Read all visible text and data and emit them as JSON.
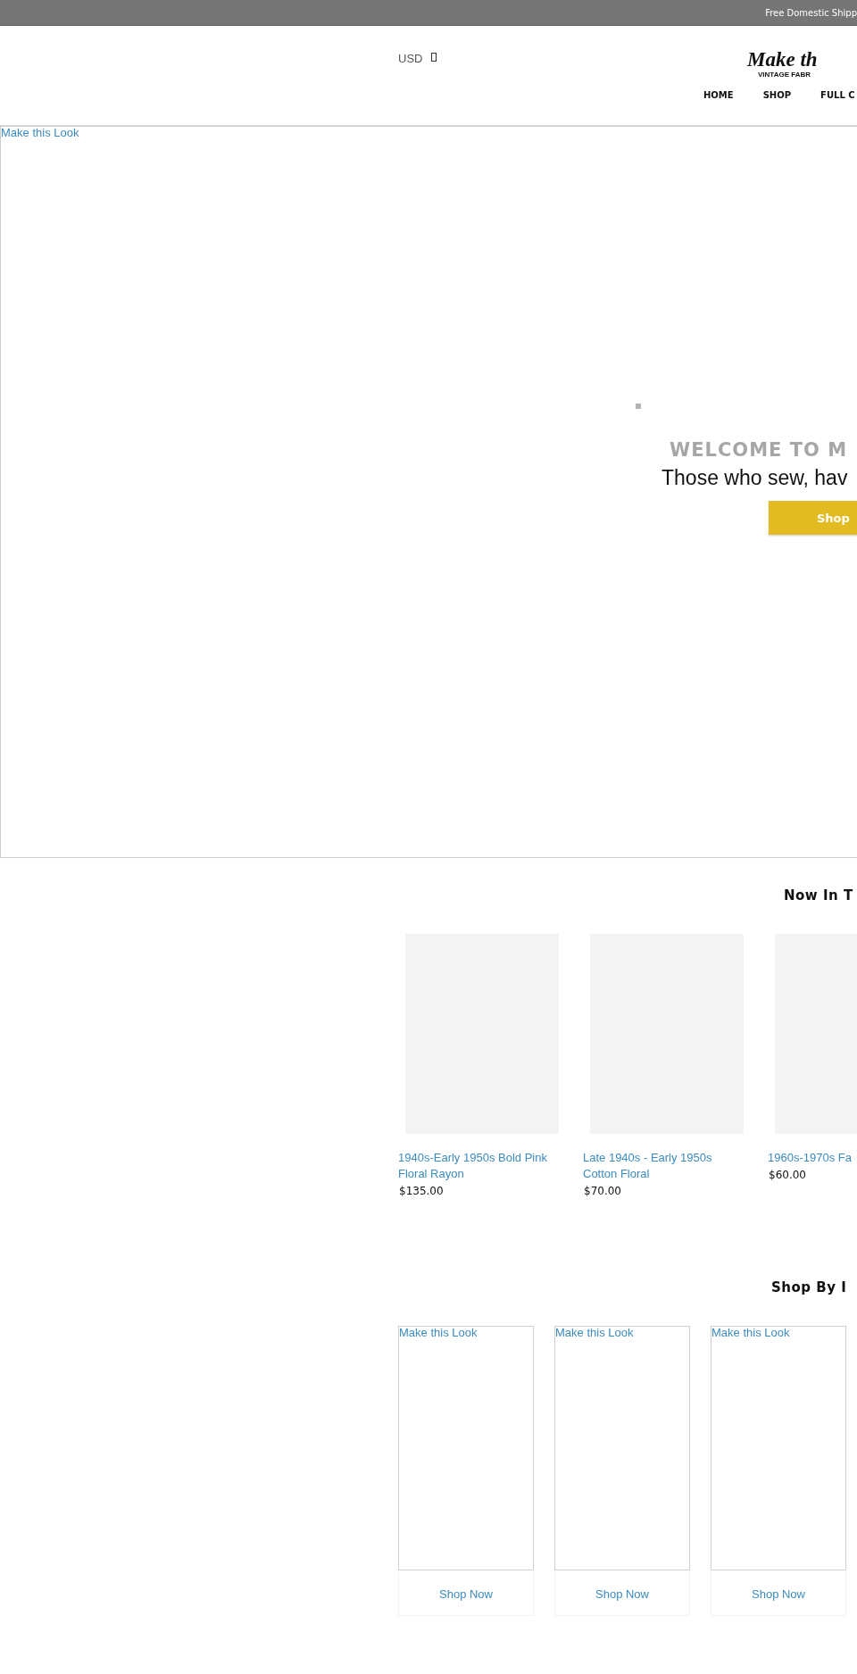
{
  "announcement": "Free Domestic Shipp",
  "header": {
    "currency": "USD",
    "logo": {
      "title": "Make th",
      "subtitle": "VINTAGE FABR"
    },
    "nav": [
      {
        "label": "HOME"
      },
      {
        "label": "SHOP"
      },
      {
        "label": "FULL C"
      }
    ]
  },
  "hero": {
    "image_alt": "Make this Look",
    "heading": "WELCOME TO M",
    "subheading": "Those who sew, hav",
    "button": "Shop"
  },
  "new_products": {
    "title": "Now In T",
    "products": [
      {
        "title": "1940s-Early 1950s Bold Pink Floral Rayon",
        "price": "$135.00"
      },
      {
        "title": "Late 1940s - Early 1950s Cotton Floral",
        "price": "$70.00"
      },
      {
        "title": "1960s-1970s Fa",
        "price": "$60.00"
      }
    ]
  },
  "collections": {
    "title": "Shop By I",
    "items": [
      {
        "image_alt": "Make this Look",
        "button": "Shop Now"
      },
      {
        "image_alt": "Make this Look",
        "button": "Shop Now"
      },
      {
        "image_alt": "Make this Look",
        "button": "Shop Now"
      }
    ]
  }
}
